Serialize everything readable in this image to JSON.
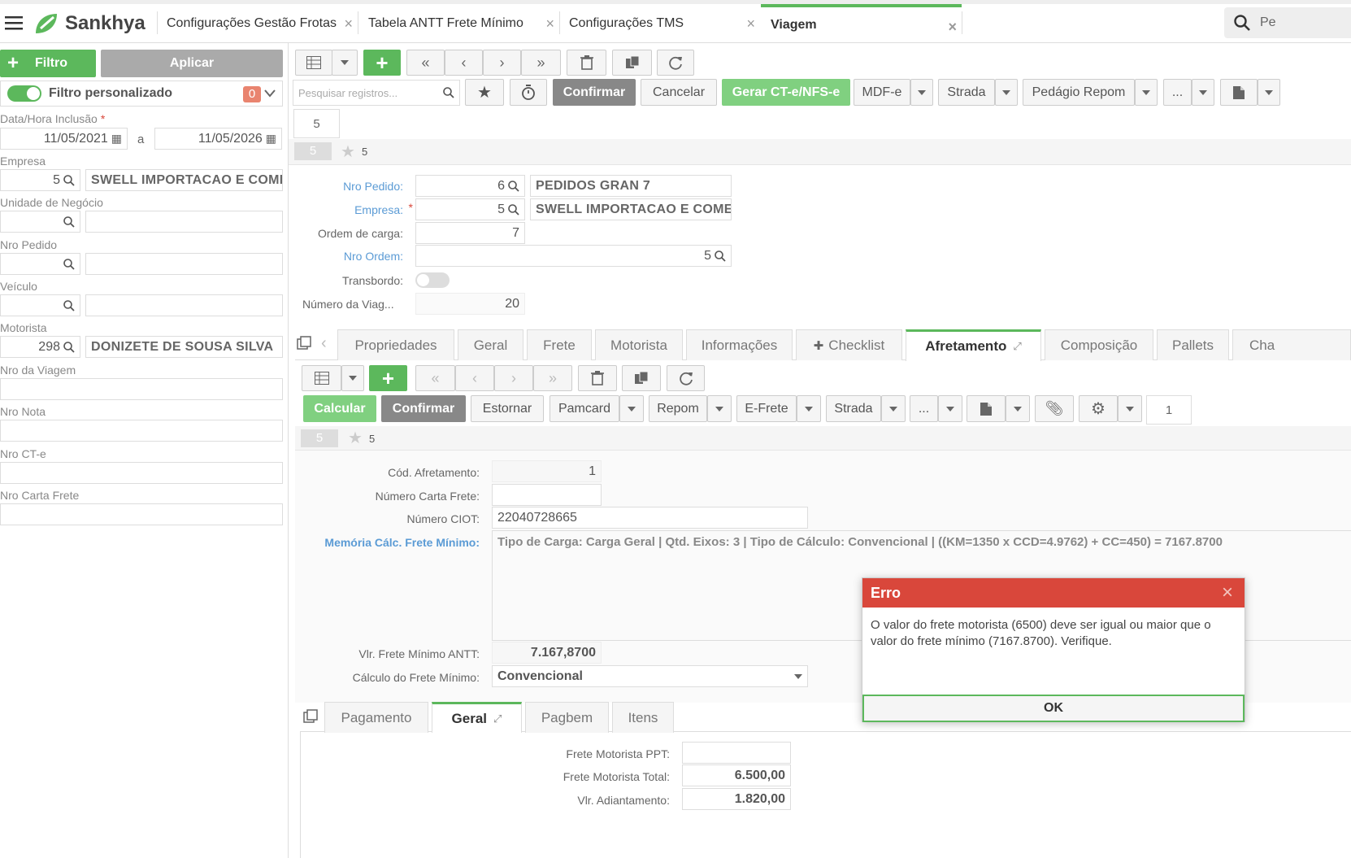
{
  "app": {
    "logo_text": "Sankhya",
    "brand_color": "#5cb85c"
  },
  "tabs": [
    {
      "label": "Configurações Gestão Frotas"
    },
    {
      "label": "Tabela ANTT Frete Mínimo"
    },
    {
      "label": "Configurações TMS"
    },
    {
      "label": "Viagem"
    }
  ],
  "search_top": {
    "value": "Pe"
  },
  "filter": {
    "filter_button": "Filtro",
    "apply_button": "Aplicar",
    "custom_filter_label": "Filtro personalizado",
    "custom_filter_count": "0",
    "date_label": "Data/Hora Inclusão",
    "date_from": "11/05/2021",
    "date_sep": "a",
    "date_to": "11/05/2026",
    "empresa_label": "Empresa",
    "empresa_code": "5",
    "empresa_name": "SWELL IMPORTACAO E COMER",
    "unidade_label": "Unidade de Negócio",
    "pedido_label": "Nro Pedido",
    "veiculo_label": "Veículo",
    "motorista_label": "Motorista",
    "motorista_code": "298",
    "motorista_name": "DONIZETE DE SOUSA SILVA",
    "viagem_label": "Nro da Viagem",
    "nota_label": "Nro Nota",
    "cte_label": "Nro CT-e",
    "carta_label": "Nro Carta Frete"
  },
  "main_toolbar": {
    "search_placeholder": "Pesquisar registros...",
    "confirm": "Confirmar",
    "cancel": "Cancelar",
    "gerar": "Gerar CT-e/NFS-e",
    "mdfe": "MDF-e",
    "strada": "Strada",
    "pedagio": "Pedágio Repom",
    "more": "...",
    "page_badge": "5",
    "record_badge": "5",
    "record_star_count": "5"
  },
  "form": {
    "pedido_label": "Nro Pedido:",
    "pedido_code": "6",
    "pedido_name": "PEDIDOS GRAN 7",
    "empresa_label": "Empresa:",
    "empresa_code": "5",
    "empresa_name": "SWELL IMPORTACAO E COMER",
    "ordem_carga_label": "Ordem de carga:",
    "ordem_carga": "7",
    "nro_ordem_label": "Nro Ordem:",
    "nro_ordem": "5",
    "transbordo_label": "Transbordo:",
    "numero_viagem_label": "Número da Viag...",
    "numero_viagem": "20"
  },
  "detail_tabs": [
    {
      "label": "Propriedades"
    },
    {
      "label": "Geral"
    },
    {
      "label": "Frete"
    },
    {
      "label": "Motorista"
    },
    {
      "label": "Informações"
    },
    {
      "label": "Checklist"
    },
    {
      "label": "Afretamento"
    },
    {
      "label": "Composição"
    },
    {
      "label": "Pallets"
    },
    {
      "label": "Cha"
    }
  ],
  "detail_toolbar": {
    "calcular": "Calcular",
    "confirmar": "Confirmar",
    "estornar": "Estornar",
    "pamcard": "Pamcard",
    "repom": "Repom",
    "efrete": "E-Frete",
    "strada": "Strada",
    "more": "...",
    "page_badge": "1",
    "record_badge": "5",
    "record_star_count": "5"
  },
  "afretamento": {
    "cod_label": "Cód. Afretamento:",
    "cod": "1",
    "carta_label": "Número Carta Frete:",
    "ciot_label": "Número CIOT:",
    "ciot": "22040728665",
    "memoria_label": "Memória Cálc. Frete Mínimo:",
    "memoria": "Tipo de Carga: Carga Geral | Qtd. Eixos: 3 | Tipo de Cálculo: Convencional | ((KM=1350 x CCD=4.9762) + CC=450) = 7167.8700",
    "vlr_label": "Vlr. Frete Mínimo ANTT:",
    "vlr": "7.167,8700",
    "calculo_label": "Cálculo do Frete Mínimo:",
    "calculo": "Convencional"
  },
  "sub_tabs": [
    {
      "label": "Pagamento"
    },
    {
      "label": "Geral"
    },
    {
      "label": "Pagbem"
    },
    {
      "label": "Itens"
    }
  ],
  "pagamento": {
    "ppt_label": "Frete Motorista PPT:",
    "total_label": "Frete Motorista Total:",
    "total": "6.500,00",
    "adiant_label": "Vlr. Adiantamento:",
    "adiant": "1.820,00"
  },
  "dialog": {
    "title": "Erro",
    "message": "O valor do frete motorista (6500) deve ser igual ou maior que o valor do frete mínimo (7167.8700). Verifique.",
    "ok": "OK",
    "header_color": "#d9473b"
  }
}
